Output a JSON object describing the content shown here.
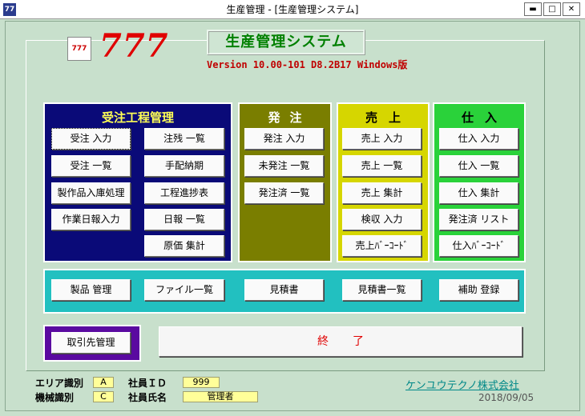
{
  "window": {
    "title": "生産管理 - [生産管理システム]",
    "icon_text": "77",
    "controls": [
      "minimize",
      "restore",
      "close"
    ]
  },
  "logo": {
    "icon_text": "777",
    "number": "777"
  },
  "system_title": "生産管理システム",
  "version": "Version 10.00-101 D8.2B17 Windows版",
  "sections": {
    "juchu": {
      "title": "受注工程管理",
      "buttons": [
        "受注 入力",
        "注残 一覧",
        "受注 一覧",
        "手配納期",
        "製作品入庫処理",
        "工程進捗表",
        "作業日報入力",
        "日報 一覧",
        "原価 集計"
      ]
    },
    "hatchu": {
      "title": "発注",
      "buttons": [
        "発注 入力",
        "未発注 一覧",
        "発注済 一覧"
      ]
    },
    "uriage": {
      "title": "売上",
      "buttons": [
        "売上 入力",
        "売上 一覧",
        "売上 集計",
        "検収 入力",
        "売上ﾊﾞｰｺｰﾄﾞ"
      ]
    },
    "shiire": {
      "title": "仕入",
      "buttons": [
        "仕入 入力",
        "仕入 一覧",
        "仕入 集計",
        "発注済 リスト",
        "仕入ﾊﾞｰｺｰﾄﾞ"
      ]
    },
    "misc": {
      "buttons": [
        "製品 管理",
        "ファイル一覧",
        "見積書",
        "見積書一覧",
        "補助 登録"
      ]
    },
    "torihiki": {
      "button": "取引先管理"
    }
  },
  "end_button": "終了",
  "status": {
    "area_label": "エリア識別",
    "area_value": "A",
    "machine_label": "機械識別",
    "machine_value": "C",
    "employee_id_label": "社員ＩＤ",
    "employee_id_value": "999",
    "employee_name_label": "社員氏名",
    "employee_name_value": "管理者"
  },
  "company": "ケンユウテクノ株式会社",
  "date": "2018/09/05",
  "colors": {
    "background": "#c8e0cc",
    "juchu": "#0a0a78",
    "hatchu": "#7a7e00",
    "uriage": "#d6d600",
    "shiire": "#2ad23a",
    "misc": "#22c0c0",
    "torihiki": "#5a0aa0",
    "accent_red": "#e00000"
  }
}
